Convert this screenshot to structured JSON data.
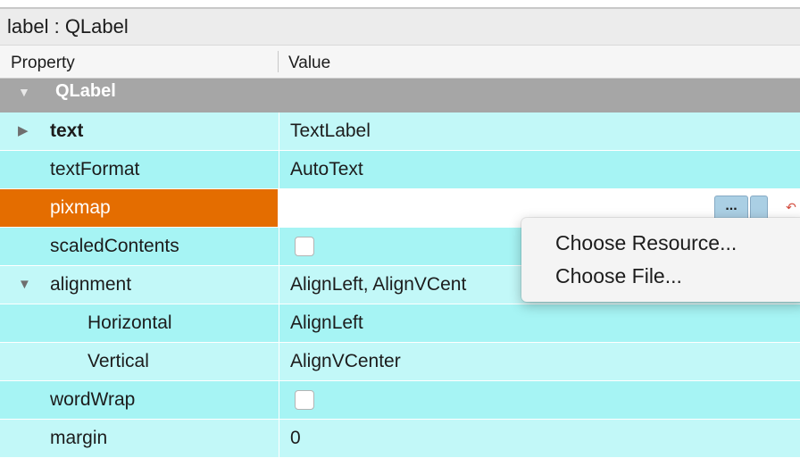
{
  "title": "label : QLabel",
  "header": {
    "col_property": "Property",
    "col_value": "Value"
  },
  "group": {
    "label": "QLabel",
    "expanded": true
  },
  "rows": [
    {
      "name": "text",
      "value": "TextLabel",
      "expander": "collapsed",
      "bold": true
    },
    {
      "name": "textFormat",
      "value": "AutoText"
    },
    {
      "name": "pixmap",
      "value": "",
      "selected": true,
      "button_label": "..."
    },
    {
      "name": "scaledContents",
      "value_type": "checkbox",
      "checked": false
    },
    {
      "name": "alignment",
      "value": "AlignLeft, AlignVCent",
      "expander": "expanded"
    },
    {
      "name": "Horizontal",
      "value": "AlignLeft",
      "child": true
    },
    {
      "name": "Vertical",
      "value": "AlignVCenter",
      "child": true
    },
    {
      "name": "wordWrap",
      "value_type": "checkbox",
      "checked": false
    },
    {
      "name": "margin",
      "value": "0"
    }
  ],
  "context_menu": {
    "items": [
      "Choose Resource...",
      "Choose File..."
    ]
  },
  "colors": {
    "row_light": "#c2f8f8",
    "row_dark": "#a6f4f4",
    "selected": "#e46d00",
    "group_bg": "#a6a6a6"
  },
  "icons": {
    "expand_collapsed": "triangle-right-icon",
    "expand_expanded": "triangle-down-icon",
    "reset": "reset-arrow-icon"
  }
}
